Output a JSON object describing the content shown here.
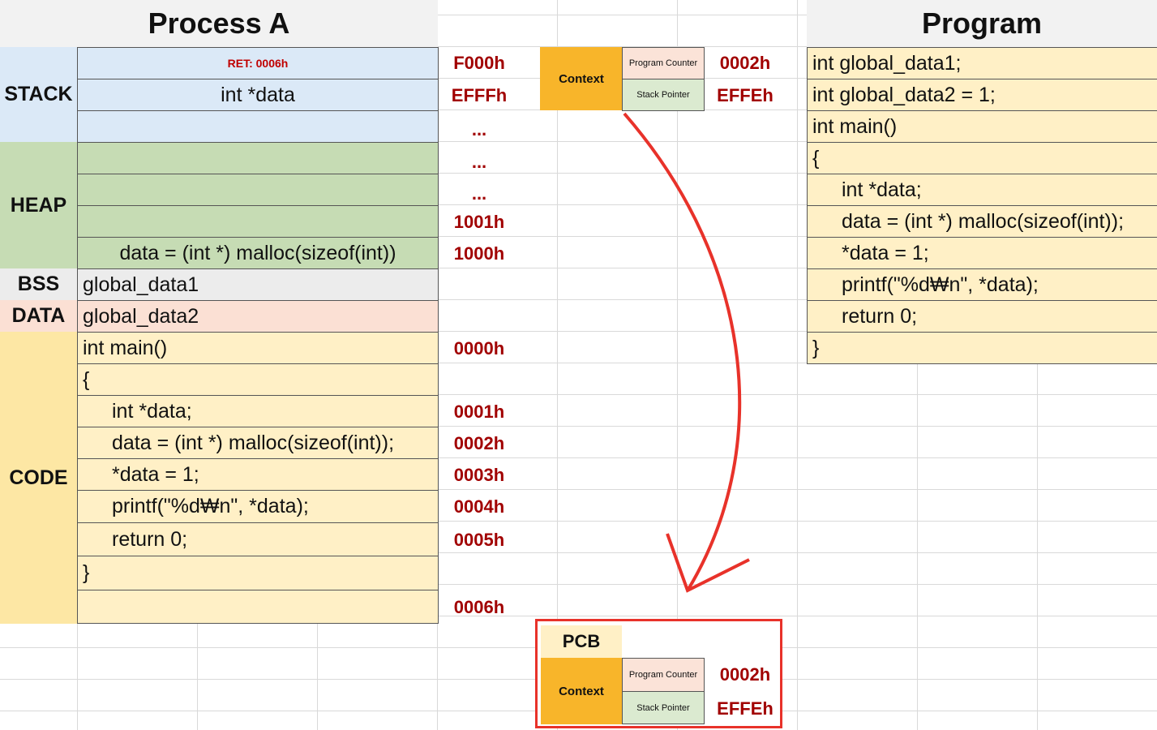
{
  "process_a": {
    "title": "Process A",
    "segments": {
      "stack": "STACK",
      "heap": "HEAP",
      "bss": "BSS",
      "data": "DATA",
      "code": "CODE"
    },
    "stack_rows": [
      "RET: 0006h",
      "int *data",
      ""
    ],
    "heap_rows": [
      "",
      "",
      "",
      "data = (int *) malloc(sizeof(int))"
    ],
    "bss_row": "global_data1",
    "data_row": "global_data2",
    "code_rows": [
      "int main()",
      "{",
      "int *data;",
      "data = (int *) malloc(sizeof(int));",
      "*data = 1;",
      "printf(\"%d₩n\", *data);",
      "return 0;",
      "}",
      ""
    ],
    "addresses": [
      "F000h",
      "EFFFh",
      "...",
      "...",
      "...",
      "1001h",
      "1000h",
      "0000h",
      "0001h",
      "0002h",
      "0003h",
      "0004h",
      "0005h",
      "0006h"
    ]
  },
  "context": {
    "label": "Context",
    "program_counter_label": "Program Counter",
    "stack_pointer_label": "Stack Pointer",
    "program_counter_value": "0002h",
    "stack_pointer_value": "EFFEh"
  },
  "pcb": {
    "title": "PCB",
    "context_label": "Context",
    "program_counter_label": "Program Counter",
    "stack_pointer_label": "Stack Pointer",
    "program_counter_value": "0002h",
    "stack_pointer_value": "EFFEh"
  },
  "program": {
    "title": "Program",
    "lines": [
      "int global_data1;",
      "int global_data2 = 1;",
      "int main()",
      "{",
      "int *data;",
      "data = (int *) malloc(sizeof(int));",
      "*data = 1;",
      "printf(\"%d₩n\", *data);",
      "return 0;",
      "}"
    ]
  },
  "colors": {
    "address_red": "#a10000",
    "arrow_red": "#e8322a",
    "context_orange": "#f8b52a"
  }
}
